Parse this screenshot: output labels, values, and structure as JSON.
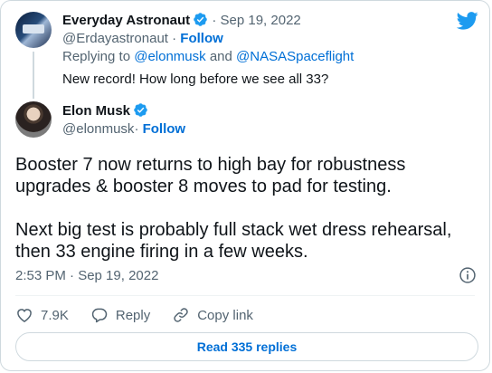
{
  "colors": {
    "brand_blue": "#1d9bf0",
    "link_blue": "#006fd6",
    "muted_gray": "#536471",
    "text": "#0f1419",
    "border": "#cfd9de"
  },
  "logo": {
    "icon": "twitter-bird-icon"
  },
  "parent_tweet": {
    "author_name": "Everyday Astronaut",
    "verified_icon": "verified-badge-icon",
    "separator": "·",
    "date": "Sep 19, 2022",
    "handle": "@Erdayastronaut",
    "follow_label": "Follow",
    "replying_prefix": "Replying to",
    "reply_user_1": "@elonmusk",
    "reply_and": "and",
    "reply_user_2": "@NASASpaceflight",
    "text": "New record! How long before we see all 33?"
  },
  "main_tweet": {
    "author_name": "Elon Musk",
    "verified_icon": "verified-badge-icon",
    "handle": "@elonmusk",
    "separator": "·",
    "follow_label": "Follow",
    "paragraph_1": "Booster 7 now returns to high bay for robustness upgrades & booster 8 moves to pad for testing.",
    "paragraph_2": "Next big test is probably full stack wet dress rehearsal, then 33 engine firing in a few weeks.",
    "time": "2:53 PM · Sep 19, 2022",
    "info_icon": "info-icon"
  },
  "actions": {
    "like_count": "7.9K",
    "like_icon": "heart-icon",
    "reply_label": "Reply",
    "reply_icon": "speech-bubble-icon",
    "copy_label": "Copy link",
    "copy_icon": "link-icon"
  },
  "footer": {
    "read_replies_label": "Read 335 replies"
  }
}
